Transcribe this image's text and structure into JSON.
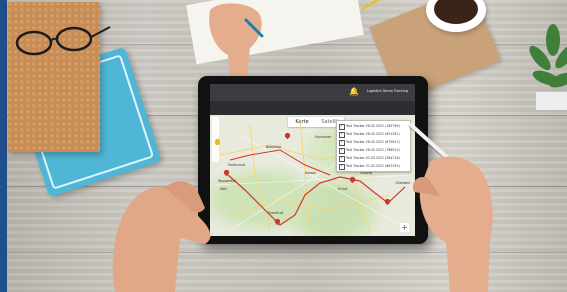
{
  "scene": {
    "description_objects": [
      "wooden-desk",
      "tablet",
      "notebooks",
      "glasses",
      "coffee-cup",
      "envelope",
      "plant",
      "hands",
      "stylus"
    ]
  },
  "app": {
    "account_label": "Logistics Demo Tracking",
    "dropdown_label": "Mehrere Teilsendungen",
    "map_tabs": [
      "Karte",
      "Satellit"
    ],
    "zoom_plus": "+",
    "trackers": [
      {
        "label": "Test Tracker 26.02.2021 (185799)",
        "checked": true
      },
      {
        "label": "Test Tracker 28.02.2021 (851281)",
        "checked": true
      },
      {
        "label": "Test Tracker 28.02.2021 (875617)",
        "checked": true
      },
      {
        "label": "Test Tracker 28.02.2021 (788510)",
        "checked": true
      },
      {
        "label": "Test Tracker 02.03.2021 (284718)",
        "checked": true
      },
      {
        "label": "Test Tracker 31.02.2021 (887259)",
        "checked": true
      }
    ],
    "cities": {
      "bielefeld": "Bielefeld",
      "dortmund": "Dortmund",
      "kassel": "Kassel",
      "erfurt": "Erfurt",
      "leipzig": "Leipzig",
      "dresden": "Dresden",
      "frankfurt": "Frankfurt",
      "koeln": "Köln",
      "hannover": "Hannover",
      "wuppertal": "Wuppertal"
    }
  },
  "colors": {
    "route": "#d6322b",
    "topbar": "#3b3d40",
    "accent_edge": "#1f4e8c"
  }
}
